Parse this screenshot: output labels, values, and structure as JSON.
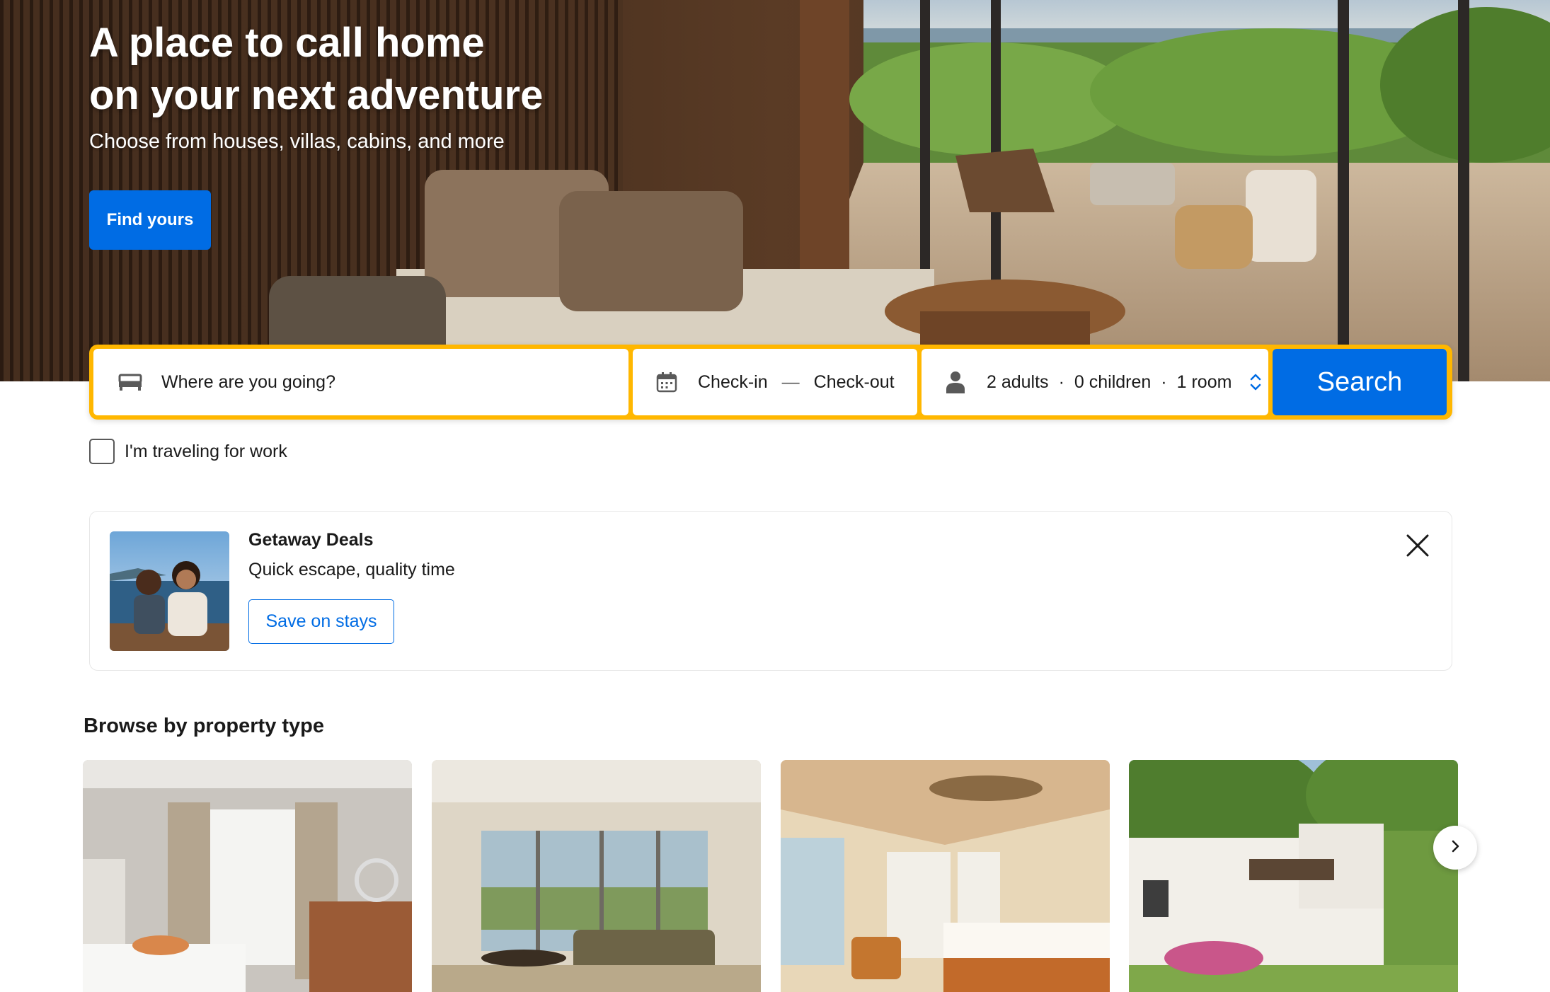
{
  "hero": {
    "title_line1": "A place to call home",
    "title_line2": "on your next adventure",
    "subtitle": "Choose from houses, villas, cabins, and more",
    "cta_label": "Find yours"
  },
  "search": {
    "destination_placeholder": "Where are you going?",
    "checkin_label": "Check-in",
    "dates_separator": "—",
    "checkout_label": "Check-out",
    "adults": "2 adults",
    "children": "0 children",
    "rooms": "1 room",
    "separator": "·",
    "button_label": "Search",
    "icons": {
      "destination": "bed-icon",
      "dates": "calendar-icon",
      "guests": "person-icon",
      "toggle": "chevron-up-down-icon"
    }
  },
  "work_travel": {
    "label": "I'm traveling for work",
    "checked": false
  },
  "deal": {
    "title": "Getaway Deals",
    "subtitle": "Quick escape, quality time",
    "button_label": "Save on stays",
    "close_icon": "close-icon"
  },
  "browse": {
    "title": "Browse by property type",
    "next_icon": "chevron-right-icon"
  },
  "colors": {
    "brand_blue": "#006ce4",
    "search_border": "#ffb700",
    "text": "#1a1a1a"
  }
}
